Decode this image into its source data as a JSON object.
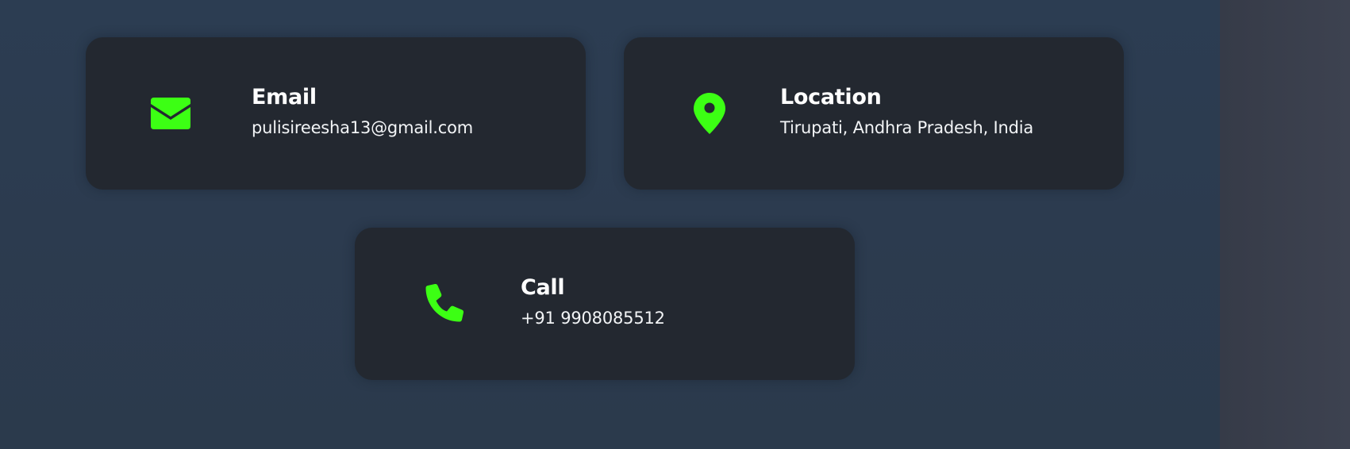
{
  "theme": {
    "accent": "#3cff14",
    "card_bg": "#232830",
    "page_bg": "#2c3d52"
  },
  "contact": {
    "email": {
      "icon": "envelope-icon",
      "title": "Email",
      "value": "pulisireesha13@gmail.com"
    },
    "location": {
      "icon": "map-pin-icon",
      "title": "Location",
      "value": "Tirupati, Andhra Pradesh, India"
    },
    "call": {
      "icon": "phone-icon",
      "title": "Call",
      "value": "+91 9908085512"
    }
  }
}
